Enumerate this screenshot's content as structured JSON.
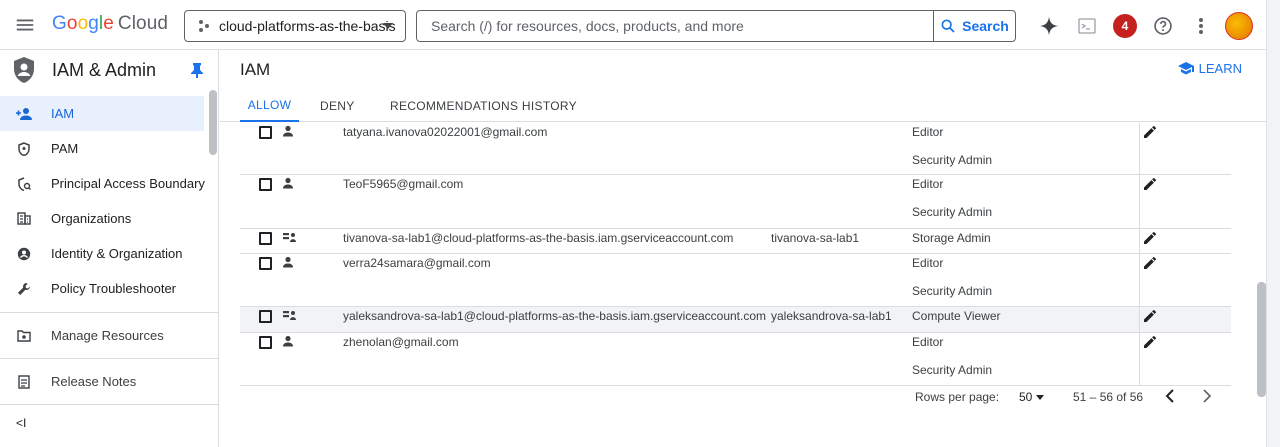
{
  "topbar": {
    "logo": {
      "g1": "G",
      "g2": "o",
      "g3": "o",
      "g4": "g",
      "g5": "l",
      "g6": "e",
      "product": "Cloud"
    },
    "project": "cloud-platforms-as-the-basis",
    "search_placeholder": "Search (/) for resources, docs, products, and more",
    "search_button": "Search",
    "notification_count": "4"
  },
  "sidebar": {
    "title": "IAM & Admin",
    "items": [
      {
        "label": "IAM",
        "icon": "person-add-icon",
        "active": true
      },
      {
        "label": "PAM",
        "icon": "shield-icon"
      },
      {
        "label": "Principal Access Boundary",
        "icon": "boundary-icon"
      },
      {
        "label": "Organizations",
        "icon": "building-icon"
      },
      {
        "label": "Identity & Organization",
        "icon": "account-circle-icon"
      },
      {
        "label": "Policy Troubleshooter",
        "icon": "wrench-icon"
      }
    ],
    "manage": "Manage Resources",
    "release": "Release Notes",
    "collapse": "<I"
  },
  "main": {
    "title": "IAM",
    "learn": "LEARN",
    "tabs": [
      "ALLOW",
      "DENY",
      "RECOMMENDATIONS HISTORY"
    ]
  },
  "rows": [
    {
      "email": "tatyana.ivanova02022001@gmail.com",
      "name": "",
      "roles": [
        "Editor",
        "Security Admin"
      ],
      "type": "user"
    },
    {
      "email": "TeoF5965@gmail.com",
      "name": "",
      "roles": [
        "Editor",
        "Security Admin"
      ],
      "type": "user"
    },
    {
      "email": "tivanova-sa-lab1@cloud-platforms-as-the-basis.iam.gserviceaccount.com",
      "name": "tivanova-sa-lab1",
      "roles": [
        "Storage Admin"
      ],
      "type": "service"
    },
    {
      "email": "verra24samara@gmail.com",
      "name": "",
      "roles": [
        "Editor",
        "Security Admin"
      ],
      "type": "user"
    },
    {
      "email": "yaleksandrova-sa-lab1@cloud-platforms-as-the-basis.iam.gserviceaccount.com",
      "name": "yaleksandrova-sa-lab1",
      "roles": [
        "Compute Viewer"
      ],
      "type": "service"
    },
    {
      "email": "zhenolan@gmail.com",
      "name": "",
      "roles": [
        "Editor",
        "Security Admin"
      ],
      "type": "user"
    }
  ],
  "pager": {
    "rows_per_page_label": "Rows per page:",
    "rows_per_page": "50",
    "range": "51 – 56 of 56"
  }
}
